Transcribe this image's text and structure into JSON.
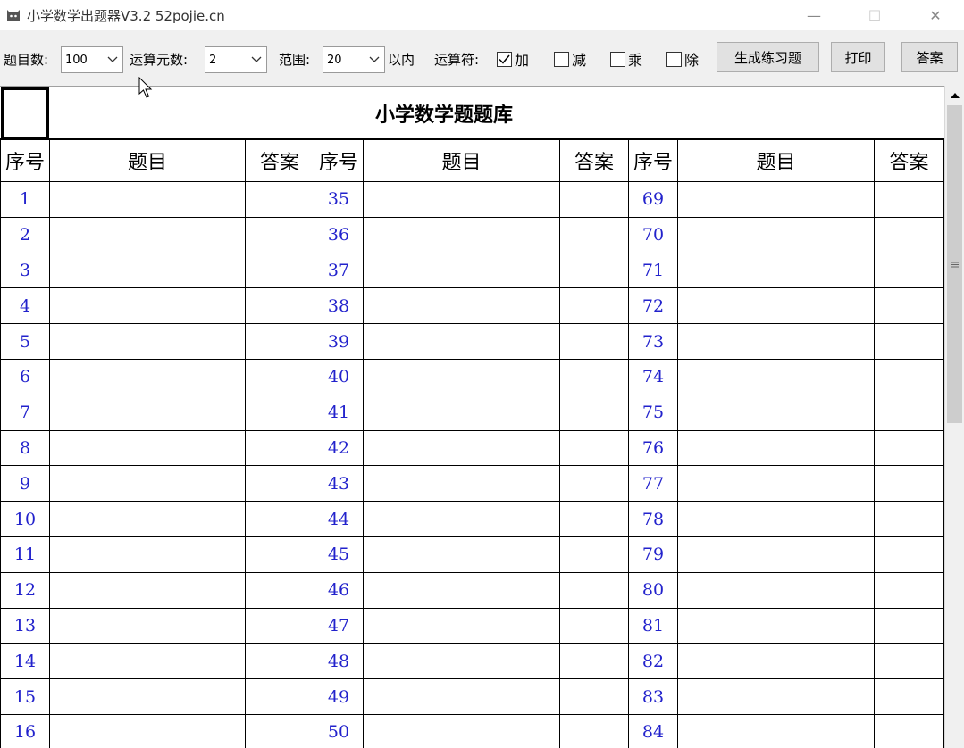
{
  "window": {
    "title": "小学数学出题器V3.2 52pojie.cn",
    "minimize": "—",
    "maximize": "☐",
    "close": "✕"
  },
  "toolbar": {
    "count_label": "题目数:",
    "count_value": "100",
    "operands_label": "运算元数:",
    "operands_value": "2",
    "range_label": "范围:",
    "range_value": "20",
    "range_suffix": "以内",
    "ops_label": "运算符:",
    "ops": [
      {
        "label": "加",
        "checked": true
      },
      {
        "label": "减",
        "checked": false
      },
      {
        "label": "乘",
        "checked": false
      },
      {
        "label": "除",
        "checked": false
      }
    ],
    "generate_button": "生成练习题",
    "print_button": "打印",
    "answer_button": "答案"
  },
  "sheet": {
    "title": "小学数学题题库",
    "headers": [
      "序号",
      "题目",
      "答案",
      "序号",
      "题目",
      "答案",
      "序号",
      "题目",
      "答案"
    ],
    "rows": [
      [
        "1",
        "35",
        "69"
      ],
      [
        "2",
        "36",
        "70"
      ],
      [
        "3",
        "37",
        "71"
      ],
      [
        "4",
        "38",
        "72"
      ],
      [
        "5",
        "39",
        "73"
      ],
      [
        "6",
        "40",
        "74"
      ],
      [
        "7",
        "41",
        "75"
      ],
      [
        "8",
        "42",
        "76"
      ],
      [
        "9",
        "43",
        "77"
      ],
      [
        "10",
        "44",
        "78"
      ],
      [
        "11",
        "45",
        "79"
      ],
      [
        "12",
        "46",
        "80"
      ],
      [
        "13",
        "47",
        "81"
      ],
      [
        "14",
        "48",
        "82"
      ],
      [
        "15",
        "49",
        "83"
      ],
      [
        "16",
        "50",
        "84"
      ]
    ]
  },
  "icons": {
    "app": "cat-logo-icon",
    "dropdown": "chevron-down-icon",
    "scroll_up": "scroll-up-icon"
  },
  "colors": {
    "number_text": "#2222cc",
    "toolbar_bg": "#f0f0f0"
  }
}
